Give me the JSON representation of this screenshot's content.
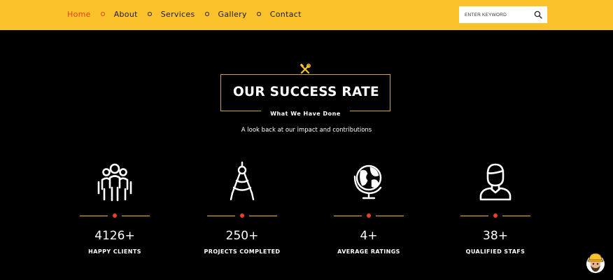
{
  "nav": {
    "items": [
      {
        "label": "Home"
      },
      {
        "label": "About"
      },
      {
        "label": "Services"
      },
      {
        "label": "Gallery"
      },
      {
        "label": "Contact"
      }
    ]
  },
  "search": {
    "placeholder": "ENTER KEYWORD",
    "icon": "search-icon"
  },
  "section": {
    "icon": "tools-icon",
    "title": "OUR SUCCESS RATE",
    "subtitle": "What We Have Done",
    "tagline": "A look back at our impact and contributions"
  },
  "stats": [
    {
      "icon": "people-group-icon",
      "value": "4126",
      "suffix": "+",
      "label": "HAPPY CLIENTS"
    },
    {
      "icon": "compass-drafting-icon",
      "value": "250",
      "suffix": "+",
      "label": "PROJECTS COMPLETED"
    },
    {
      "icon": "globe-icon",
      "value": "4",
      "suffix": "+",
      "label": "AVERAGE RATINGS"
    },
    {
      "icon": "worker-icon",
      "value": "38",
      "suffix": "+",
      "label": "QUALIFIED STAFS"
    }
  ],
  "colors": {
    "brand": "#fcc22b",
    "accent": "#e8421f",
    "gold": "#c9a24a",
    "background": "#000000"
  },
  "chat_widget": {
    "icon": "builder-mascot-icon"
  }
}
